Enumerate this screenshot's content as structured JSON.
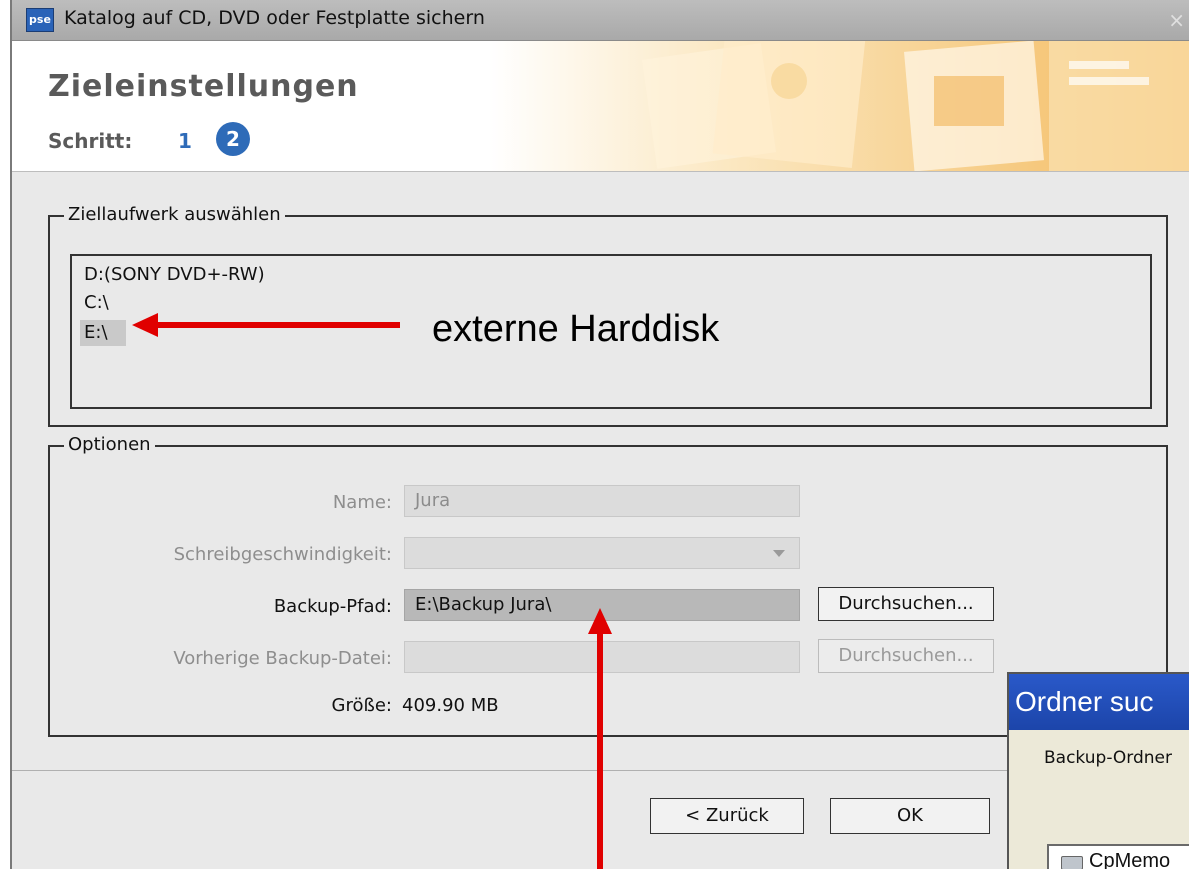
{
  "window": {
    "title": "Katalog auf CD, DVD oder Festplatte sichern",
    "app_icon": "pse",
    "close_glyph": "×"
  },
  "header": {
    "title": "Zieleinstellungen",
    "step_label": "Schritt:",
    "step_1": "1",
    "step_2": "2"
  },
  "drive_group": {
    "legend": "Ziellaufwerk auswählen",
    "drives": [
      {
        "label": "D:(SONY DVD+-RW)",
        "selected": false
      },
      {
        "label": "C:\\",
        "selected": false
      },
      {
        "label": "E:\\",
        "selected": true
      }
    ]
  },
  "options_group": {
    "legend": "Optionen",
    "name_label": "Name:",
    "name_value": "Jura",
    "speed_label": "Schreibgeschwindigkeit:",
    "speed_value": "",
    "backup_path_label": "Backup-Pfad:",
    "backup_path_value": "E:\\Backup Jura\\",
    "browse_label": "Durchsuchen...",
    "prev_backup_label": "Vorherige Backup-Datei:",
    "prev_backup_value": "",
    "browse2_label": "Durchsuchen...",
    "size_label": "Größe:",
    "size_value": "409.90 MB"
  },
  "footer": {
    "back_label": "< Zurück",
    "ok_label": "OK"
  },
  "annotation": {
    "text": "externe Harddisk",
    "color": "#e00000"
  },
  "dialog2": {
    "title": "Ordner suc",
    "text": "Backup-Ordner",
    "tree_item": "CpMemo"
  },
  "colors": {
    "accent_blue": "#2e6bb8",
    "xp_title": "#2a59c9"
  }
}
